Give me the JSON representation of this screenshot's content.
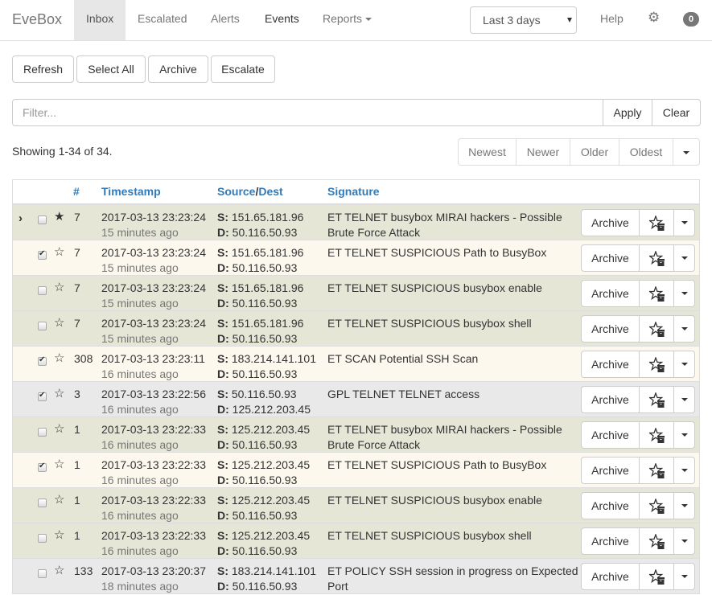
{
  "navbar": {
    "brand": "EveBox",
    "items": [
      {
        "label": "Inbox",
        "active": true
      },
      {
        "label": "Escalated"
      },
      {
        "label": "Alerts"
      },
      {
        "label": "Events"
      },
      {
        "label": "Reports"
      }
    ],
    "time_range": "Last 3 days",
    "help": "Help",
    "settings_icon": "gear-icon",
    "badge_count": "0"
  },
  "toolbar": {
    "refresh": "Refresh",
    "select_all": "Select All",
    "archive": "Archive",
    "escalate": "Escalate"
  },
  "filter": {
    "placeholder": "Filter...",
    "value": "",
    "apply": "Apply",
    "clear": "Clear"
  },
  "status": {
    "showing": "Showing 1-34 of 34."
  },
  "pager": {
    "newest": "Newest",
    "newer": "Newer",
    "older": "Older",
    "oldest": "Oldest"
  },
  "table": {
    "headers": {
      "count": "#",
      "timestamp": "Timestamp",
      "source": "Source",
      "slash": "/",
      "dest": "Dest",
      "signature": "Signature"
    },
    "src_label": "S:",
    "dst_label": "D:",
    "archive_label": "Archive",
    "rows": [
      {
        "count": "7",
        "timestamp": "2017-03-13 23:23:24",
        "ago": "15 minutes ago",
        "src": "151.65.181.96",
        "dst": "50.116.50.93",
        "signature": "ET TELNET busybox MIRAI hackers - Possible Brute Force Attack",
        "checked": false,
        "starred": true,
        "current": true,
        "color": "olive"
      },
      {
        "count": "7",
        "timestamp": "2017-03-13 23:23:24",
        "ago": "15 minutes ago",
        "src": "151.65.181.96",
        "dst": "50.116.50.93",
        "signature": "ET TELNET SUSPICIOUS Path to BusyBox",
        "checked": true,
        "starred": false,
        "color": "cream"
      },
      {
        "count": "7",
        "timestamp": "2017-03-13 23:23:24",
        "ago": "15 minutes ago",
        "src": "151.65.181.96",
        "dst": "50.116.50.93",
        "signature": "ET TELNET SUSPICIOUS busybox enable",
        "checked": false,
        "starred": false,
        "color": "olive"
      },
      {
        "count": "7",
        "timestamp": "2017-03-13 23:23:24",
        "ago": "15 minutes ago",
        "src": "151.65.181.96",
        "dst": "50.116.50.93",
        "signature": "ET TELNET SUSPICIOUS busybox shell",
        "checked": false,
        "starred": false,
        "color": "olive"
      },
      {
        "count": "308",
        "timestamp": "2017-03-13 23:23:11",
        "ago": "16 minutes ago",
        "src": "183.214.141.101",
        "dst": "50.116.50.93",
        "signature": "ET SCAN Potential SSH Scan",
        "checked": true,
        "starred": false,
        "color": "cream"
      },
      {
        "count": "3",
        "timestamp": "2017-03-13 23:22:56",
        "ago": "16 minutes ago",
        "src": "50.116.50.93",
        "dst": "125.212.203.45",
        "signature": "GPL TELNET TELNET access",
        "checked": true,
        "starred": false,
        "color": "grey"
      },
      {
        "count": "1",
        "timestamp": "2017-03-13 23:22:33",
        "ago": "16 minutes ago",
        "src": "125.212.203.45",
        "dst": "50.116.50.93",
        "signature": "ET TELNET busybox MIRAI hackers - Possible Brute Force Attack",
        "checked": false,
        "starred": false,
        "color": "olive"
      },
      {
        "count": "1",
        "timestamp": "2017-03-13 23:22:33",
        "ago": "16 minutes ago",
        "src": "125.212.203.45",
        "dst": "50.116.50.93",
        "signature": "ET TELNET SUSPICIOUS Path to BusyBox",
        "checked": true,
        "starred": false,
        "color": "cream"
      },
      {
        "count": "1",
        "timestamp": "2017-03-13 23:22:33",
        "ago": "16 minutes ago",
        "src": "125.212.203.45",
        "dst": "50.116.50.93",
        "signature": "ET TELNET SUSPICIOUS busybox enable",
        "checked": false,
        "starred": false,
        "color": "olive"
      },
      {
        "count": "1",
        "timestamp": "2017-03-13 23:22:33",
        "ago": "16 minutes ago",
        "src": "125.212.203.45",
        "dst": "50.116.50.93",
        "signature": "ET TELNET SUSPICIOUS busybox shell",
        "checked": false,
        "starred": false,
        "color": "olive"
      },
      {
        "count": "133",
        "timestamp": "2017-03-13 23:20:37",
        "ago": "18 minutes ago",
        "src": "183.214.141.101",
        "dst": "50.116.50.93",
        "signature": "ET POLICY SSH session in progress on Expected Port",
        "checked": false,
        "starred": false,
        "color": "grey"
      }
    ]
  }
}
